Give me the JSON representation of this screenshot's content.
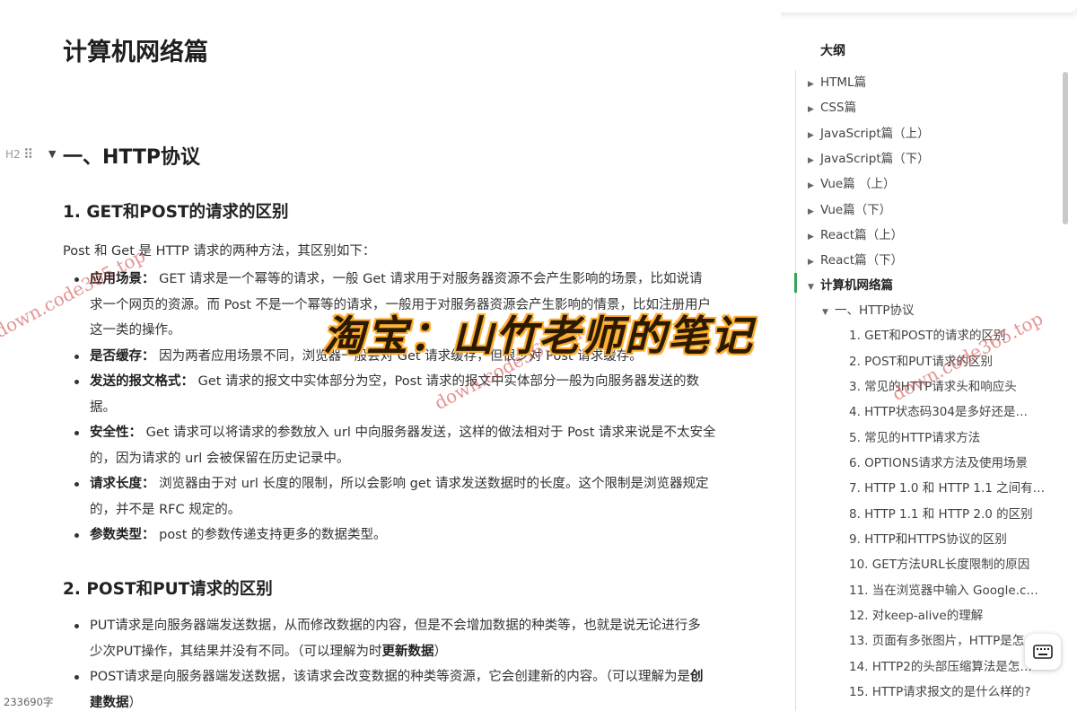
{
  "document": {
    "title": "计算机网络篇",
    "h2_marker": "H2",
    "h2": "一、HTTP协议",
    "section1": {
      "heading": "1. GET和POST的请求的区别",
      "intro": "Post 和 Get 是 HTTP 请求的两种方法，其区别如下：",
      "bullets": [
        {
          "label": "应用场景：",
          "lines": [
            "GET 请求是一个幂等的请求，一般 Get 请求用于对服务器资源不会产生影响的场景，比如说请",
            "求一个网页的资源。而 Post 不是一个幂等的请求，一般用于对服务器资源会产生影响的情景，比如注册用户",
            "这一类的操作。"
          ]
        },
        {
          "label": "是否缓存：",
          "lines": [
            "因为两者应用场景不同，浏览器一般会对 Get 请求缓存，但很少对 Post 请求缓存。"
          ]
        },
        {
          "label": "发送的报文格式：",
          "lines": [
            "Get 请求的报文中实体部分为空，Post 请求的报文中实体部分一般为向服务器发送的数",
            "据。"
          ]
        },
        {
          "label": "安全性：",
          "lines": [
            "Get 请求可以将请求的参数放入 url 中向服务器发送，这样的做法相对于 Post 请求来说是不太安全",
            "的，因为请求的 url 会被保留在历史记录中。"
          ]
        },
        {
          "label": "请求长度：",
          "lines": [
            "浏览器由于对 url 长度的限制，所以会影响 get 请求发送数据时的长度。这个限制是浏览器规定",
            "的，并不是 RFC 规定的。"
          ]
        },
        {
          "label": "参数类型：",
          "lines": [
            "post 的参数传递支持更多的数据类型。"
          ]
        }
      ]
    },
    "section2": {
      "heading": "2. POST和PUT请求的区别",
      "bullets": [
        {
          "line1": "PUT请求是向服务器端发送数据，从而修改数据的内容，但是不会增加数据的种类等，也就是说无论进行多",
          "line2_pre": "少次PUT操作，其结果并没有不同。（可以理解为时",
          "line2_bold": "更新数据",
          "line2_post": "）"
        },
        {
          "line1_pre": "POST请求是向服务器端发送数据，该请求会改变数据的种类等资源，它会创建新的内容。（可以理解为是",
          "line1_bold": "创",
          "line2_bold": "建数据",
          "line2_post": "）"
        }
      ]
    },
    "word_count": "233690字"
  },
  "outline": {
    "title": "大纲",
    "top_items": [
      {
        "label": "HTML篇"
      },
      {
        "label": "CSS篇"
      },
      {
        "label": "JavaScript篇（上）"
      },
      {
        "label": "JavaScript篇（下）"
      },
      {
        "label": "Vue篇 （上）"
      },
      {
        "label": "Vue篇（下）"
      },
      {
        "label": "React篇（上）"
      },
      {
        "label": "React篇（下）"
      }
    ],
    "active_item": "计算机网络篇",
    "sub_item": "一、HTTP协议",
    "sub_sub_items": [
      "1. GET和POST的请求的区别",
      "2. POST和PUT请求的区别",
      "3. 常见的HTTP请求头和响应头",
      "4. HTTP状态码304是多好还是…",
      "5. 常见的HTTP请求方法",
      "6. OPTIONS请求方法及使用场景",
      "7. HTTP 1.0 和 HTTP 1.1 之间有…",
      "8. HTTP 1.1 和 HTTP 2.0 的区别",
      "9. HTTP和HTTPS协议的区别",
      "10. GET方法URL长度限制的原因",
      "11. 当在浏览器中输入 Google.c…",
      "12. 对keep-alive的理解",
      "13. 页面有多张图片，HTTP是怎…",
      "14. HTTP2的头部压缩算法是怎…",
      "15. HTTP请求报文的是什么样的?"
    ],
    "active_color": "#36a35a"
  },
  "overlay": {
    "banner": "淘宝：山竹老师的笔记",
    "watermarks": [
      "down.code365.top",
      "down.code365.top",
      "down.code365.top"
    ]
  }
}
